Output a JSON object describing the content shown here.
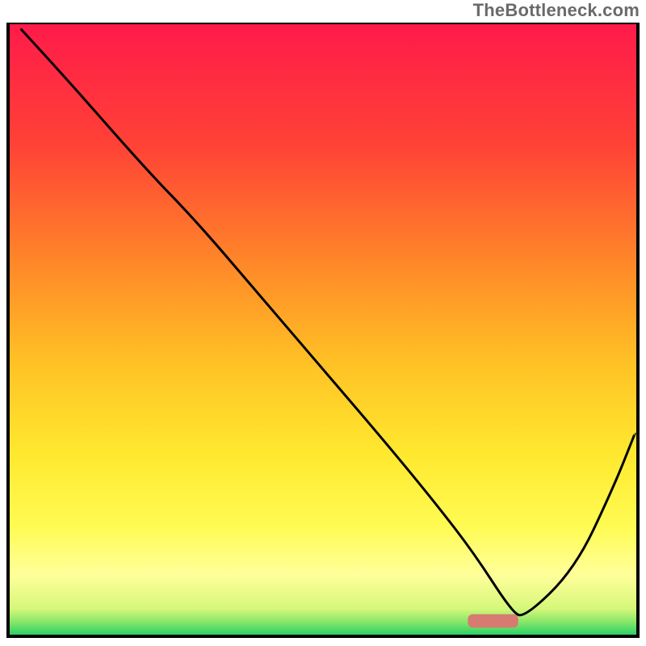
{
  "attribution": "TheBottleneck.com",
  "chart_data": {
    "type": "line",
    "title": "",
    "xlabel": "",
    "ylabel": "",
    "xlim": [
      0,
      100
    ],
    "ylim": [
      0,
      100
    ],
    "gradient_stops": [
      {
        "offset": 0.0,
        "color": "#ff1a4a"
      },
      {
        "offset": 0.2,
        "color": "#ff4236"
      },
      {
        "offset": 0.4,
        "color": "#ff8a28"
      },
      {
        "offset": 0.55,
        "color": "#ffc025"
      },
      {
        "offset": 0.7,
        "color": "#ffe82e"
      },
      {
        "offset": 0.82,
        "color": "#fffb52"
      },
      {
        "offset": 0.9,
        "color": "#ffff9a"
      },
      {
        "offset": 0.955,
        "color": "#d6f77a"
      },
      {
        "offset": 0.975,
        "color": "#8de86a"
      },
      {
        "offset": 1.0,
        "color": "#20cf66"
      }
    ],
    "series": [
      {
        "name": "bottleneck-curve",
        "x": [
          2.0,
          10.0,
          22.0,
          30.0,
          40.0,
          50.0,
          60.0,
          68.0,
          74.0,
          80.0,
          82.0,
          90.0,
          96.0,
          99.5
        ],
        "y": [
          99.0,
          90.0,
          76.0,
          67.5,
          55.5,
          43.5,
          31.5,
          21.5,
          13.5,
          4.0,
          3.0,
          11.0,
          24.0,
          33.0
        ]
      }
    ],
    "marker": {
      "x_center": 77.0,
      "y": 2.5,
      "width": 8.0,
      "height": 2.2
    },
    "legend": null,
    "annotations": []
  }
}
